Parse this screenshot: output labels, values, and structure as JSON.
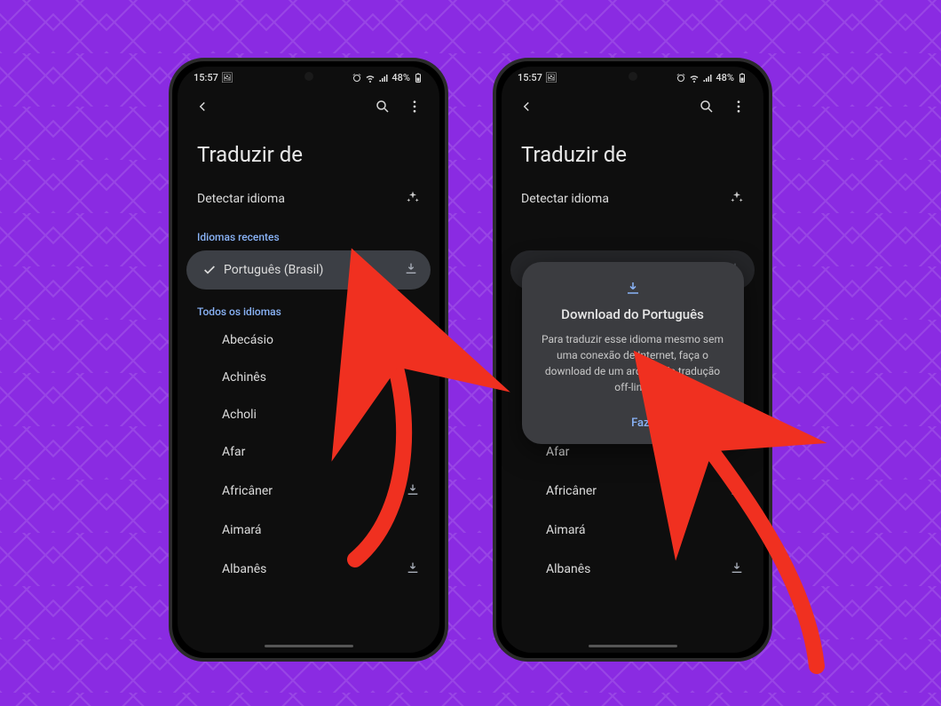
{
  "status": {
    "time": "15:57",
    "battery": "48%"
  },
  "header": {
    "title": "Traduzir de"
  },
  "detect": {
    "label": "Detectar idioma"
  },
  "sections": {
    "recent": "Idiomas recentes",
    "all": "Todos os idiomas"
  },
  "recent": [
    {
      "name": "Português (Brasil)",
      "selected": true,
      "downloadable": true
    }
  ],
  "languages": [
    {
      "name": "Abecásio",
      "downloadable": false
    },
    {
      "name": "Achinês",
      "downloadable": false
    },
    {
      "name": "Acholi",
      "downloadable": false
    },
    {
      "name": "Afar",
      "downloadable": false
    },
    {
      "name": "Africâner",
      "downloadable": true
    },
    {
      "name": "Aimará",
      "downloadable": false
    },
    {
      "name": "Albanês",
      "downloadable": true
    }
  ],
  "dialog": {
    "title": "Download do Português",
    "body": "Para traduzir esse idioma mesmo sem uma conexão de Internet, faça o download de um arquivo de tradução off-line.",
    "action": "Fazer o download"
  }
}
